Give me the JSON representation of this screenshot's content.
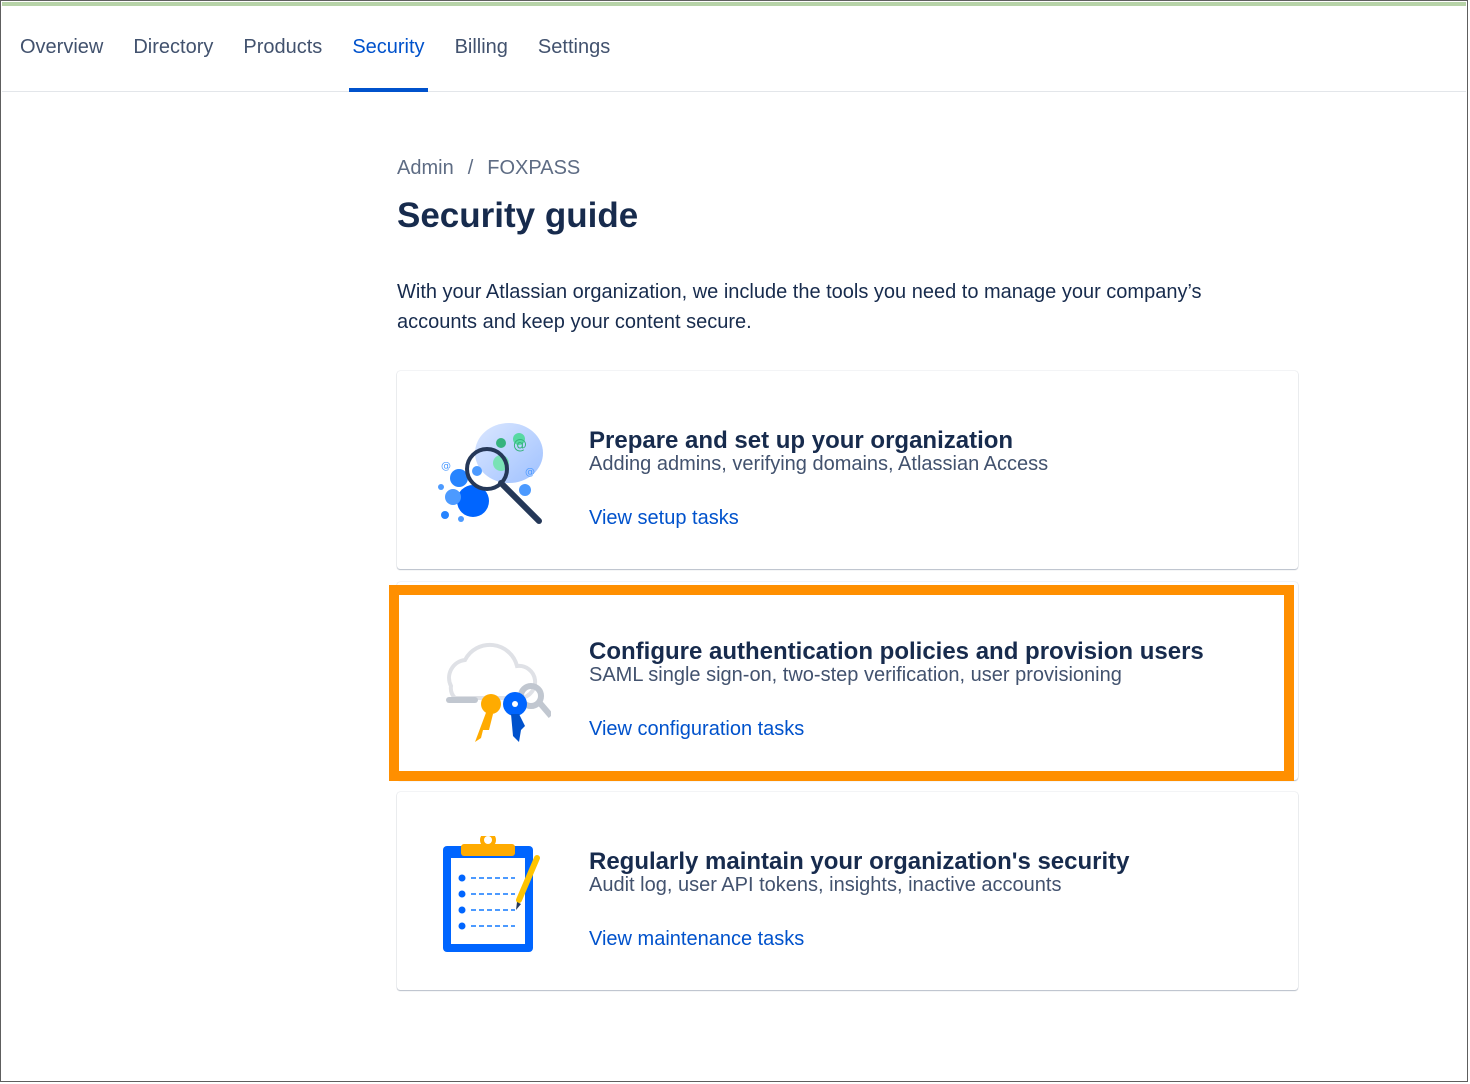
{
  "nav": {
    "tabs": [
      {
        "label": "Overview"
      },
      {
        "label": "Directory"
      },
      {
        "label": "Products"
      },
      {
        "label": "Security",
        "active": true
      },
      {
        "label": "Billing"
      },
      {
        "label": "Settings"
      }
    ]
  },
  "breadcrumb": {
    "root": "Admin",
    "separator": "/",
    "current": "FOXPASS"
  },
  "page": {
    "title": "Security guide",
    "intro": "With your Atlassian organization, we include the tools you need to manage your company’s accounts and keep your content secure."
  },
  "cards": [
    {
      "icon": "people-search-illustration",
      "title": "Prepare and set up your organization",
      "description": "Adding admins, verifying domains, Atlassian Access",
      "link": "View setup tasks"
    },
    {
      "icon": "cloud-keys-illustration",
      "title": "Configure authentication policies and provision users",
      "description": "SAML single sign-on, two-step verification, user provisioning",
      "link": "View configuration tasks",
      "highlighted": true
    },
    {
      "icon": "clipboard-checklist-illustration",
      "title": "Regularly maintain your organization's security",
      "description": "Audit log, user API tokens, insights, inactive accounts",
      "link": "View maintenance tasks"
    }
  ],
  "colors": {
    "accent": "#0052cc",
    "highlight": "#ff8f00",
    "text_primary": "#172b4d",
    "text_secondary": "#42526e"
  }
}
